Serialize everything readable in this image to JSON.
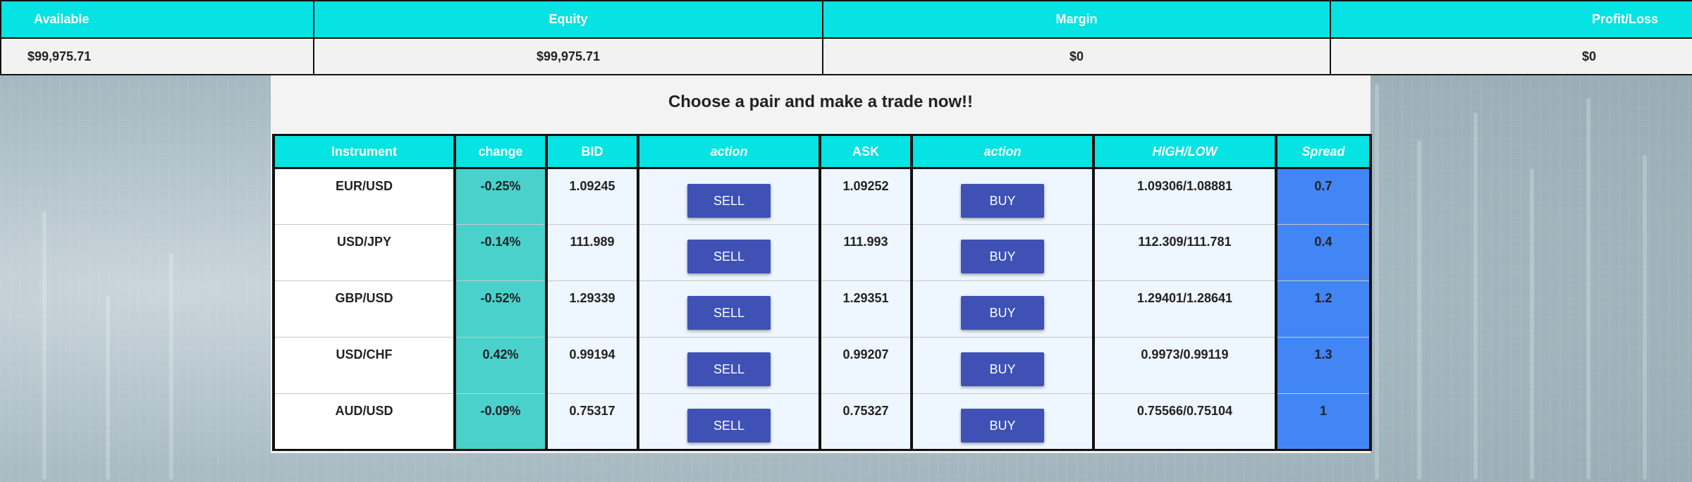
{
  "account": {
    "headers": [
      "Available",
      "Equity",
      "Margin",
      "Profit/Loss"
    ],
    "values": [
      "$99,975.71",
      "$99,975.71",
      "$0",
      "$0"
    ]
  },
  "panel": {
    "title": "Choose a pair and make a trade now!!",
    "columns": {
      "instrument": "Instrument",
      "change": "change",
      "bid": "BID",
      "action_sell": "action",
      "ask": "ASK",
      "action_buy": "action",
      "high_low": "HIGH/LOW",
      "spread": "Spread"
    },
    "sell_label": "SELL",
    "buy_label": "BUY",
    "rows": [
      {
        "instrument": "EUR/USD",
        "change": "-0.25%",
        "bid": "1.09245",
        "ask": "1.09252",
        "high_low": "1.09306/1.08881",
        "spread": "0.7"
      },
      {
        "instrument": "USD/JPY",
        "change": "-0.14%",
        "bid": "111.989",
        "ask": "111.993",
        "high_low": "112.309/111.781",
        "spread": "0.4"
      },
      {
        "instrument": "GBP/USD",
        "change": "-0.52%",
        "bid": "1.29339",
        "ask": "1.29351",
        "high_low": "1.29401/1.28641",
        "spread": "1.2"
      },
      {
        "instrument": "USD/CHF",
        "change": "0.42%",
        "bid": "0.99194",
        "ask": "0.99207",
        "high_low": "0.9973/0.99119",
        "spread": "1.3"
      },
      {
        "instrument": "AUD/USD",
        "change": "-0.09%",
        "bid": "0.75317",
        "ask": "0.75327",
        "high_low": "0.75566/0.75104",
        "spread": "1"
      }
    ]
  },
  "colors": {
    "header_accent": "#06e3e3",
    "change_column": "#4ad1cc",
    "spread_column": "#4285f4",
    "button": "#3f51b5"
  }
}
